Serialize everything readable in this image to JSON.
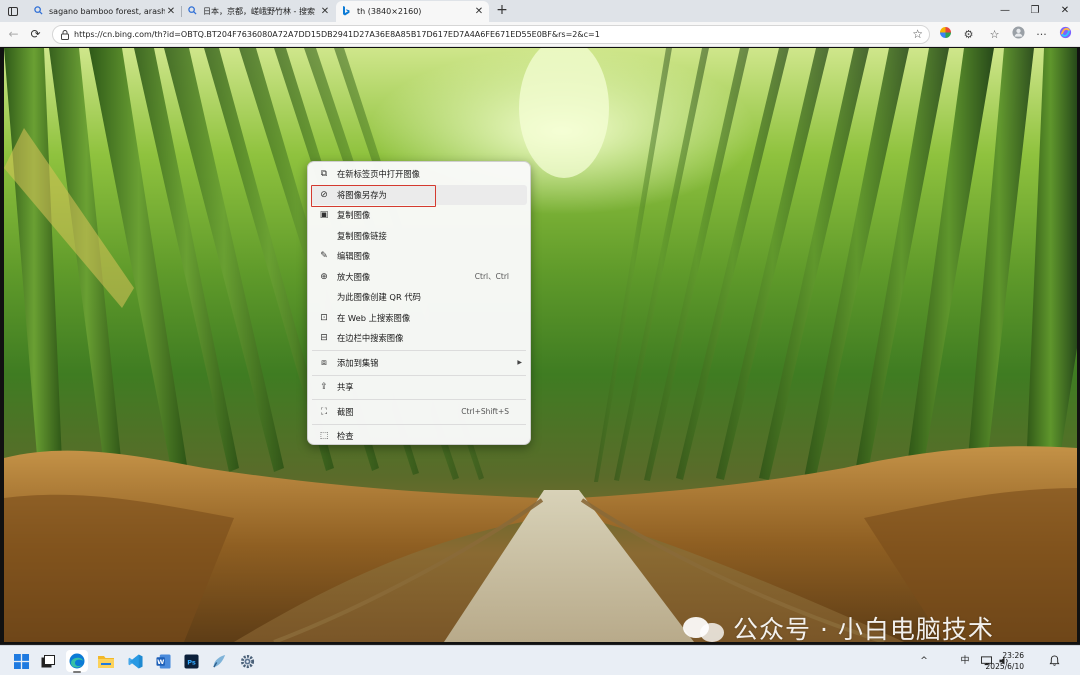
{
  "browser": {
    "tabs": [
      {
        "title": "sagano bamboo forest, arashiyama",
        "favicon": "search-icon",
        "active": false
      },
      {
        "title": "日本，京都，嵯峨野竹林 - 搜索",
        "favicon": "search-icon",
        "active": false
      },
      {
        "title": "th (3840×2160)",
        "favicon": "bing-icon",
        "active": true
      }
    ],
    "new_tab_label": "+",
    "window_controls": {
      "minimize": "—",
      "maximize": "❐",
      "close": "✕"
    }
  },
  "address_bar": {
    "url": "https://cn.bing.com/th?id=OBTQ.BT204F7636080A72A7DD15DB2941D27A36E8A85B17D617ED7A4A6FE671ED55E0BF&rs=2&c=1"
  },
  "context_menu": {
    "items": [
      {
        "label": "在新标签页中打开图像",
        "icon": "open-in-new-tab-icon",
        "shortcut": "",
        "submenu": false,
        "highlighted": false
      },
      {
        "label": "将图像另存为",
        "icon": "save-image-icon",
        "shortcut": "",
        "submenu": false,
        "highlighted": true
      },
      {
        "label": "复制图像",
        "icon": "copy-image-icon",
        "shortcut": "",
        "submenu": false,
        "highlighted": false
      },
      {
        "label": "复制图像链接",
        "icon": "",
        "shortcut": "",
        "submenu": false,
        "highlighted": false
      },
      {
        "label": "编辑图像",
        "icon": "edit-image-icon",
        "shortcut": "",
        "submenu": false,
        "highlighted": false
      },
      {
        "label": "放大图像",
        "icon": "zoom-in-icon",
        "shortcut": "Ctrl、Ctrl",
        "submenu": false,
        "highlighted": false
      },
      {
        "label": "为此图像创建 QR 代码",
        "icon": "",
        "shortcut": "",
        "submenu": false,
        "highlighted": false
      },
      {
        "label": "在 Web 上搜索图像",
        "icon": "visual-search-icon",
        "shortcut": "",
        "submenu": false,
        "highlighted": false
      },
      {
        "label": "在边栏中搜索图像",
        "icon": "sidebar-search-icon",
        "shortcut": "",
        "submenu": false,
        "highlighted": false
      }
    ],
    "group2": [
      {
        "label": "添加到集锦",
        "icon": "collections-icon",
        "shortcut": "",
        "submenu": true
      }
    ],
    "group3": [
      {
        "label": "共享",
        "icon": "share-icon",
        "shortcut": "",
        "submenu": false
      }
    ],
    "group4": [
      {
        "label": "截图",
        "icon": "screenshot-icon",
        "shortcut": "Ctrl+Shift+S",
        "submenu": false
      }
    ],
    "group5": [
      {
        "label": "检查",
        "icon": "inspect-icon",
        "shortcut": "",
        "submenu": false
      }
    ]
  },
  "watermark": {
    "text": "公众号 · 小白电脑技术"
  },
  "taskbar": {
    "apps": [
      "start-icon",
      "task-view-icon",
      "edge-icon",
      "file-explorer-icon",
      "vscode-icon",
      "word-icon",
      "photoshop-icon",
      "paint-icon",
      "settings-icon"
    ],
    "tray": {
      "chevron": "^",
      "ime": "中"
    },
    "time": "23:26",
    "date": "2025/6/10"
  },
  "colors": {
    "highlight_border": "#d43a2f",
    "edge_blue": "#0c7bd6"
  }
}
